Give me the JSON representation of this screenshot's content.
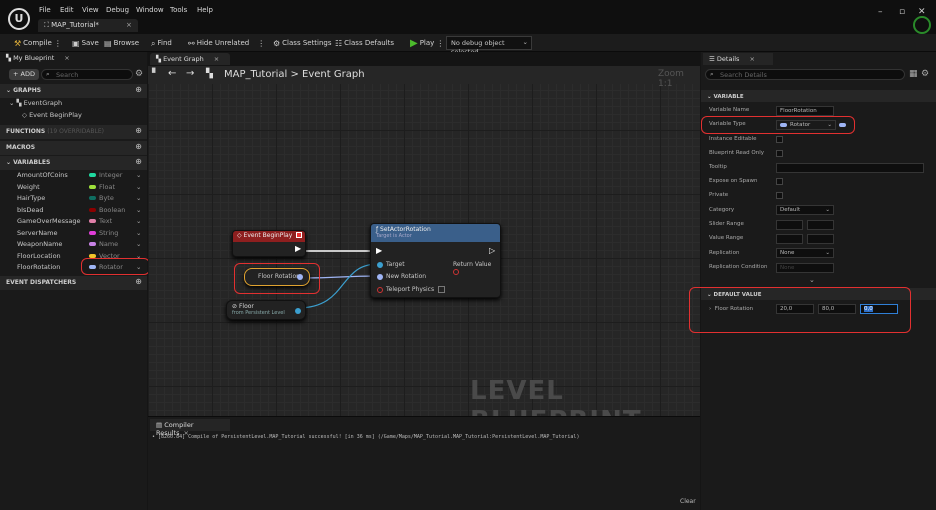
{
  "window": {
    "tab": "MAP_Tutorial*",
    "menus": [
      "File",
      "Edit",
      "View",
      "Debug",
      "Window",
      "Tools",
      "Help"
    ]
  },
  "toolbar": {
    "compile": "Compile",
    "save": "Save",
    "browse": "Browse",
    "find": "Find",
    "hide_unrelated": "Hide Unrelated",
    "class_settings": "Class Settings",
    "class_defaults": "Class Defaults",
    "play": "Play",
    "debug_select": "No debug object selected"
  },
  "myblueprint": {
    "tab": "My Blueprint",
    "add": "ADD",
    "search_ph": "Search",
    "graphs": "GRAPHS",
    "eventgraph": "EventGraph",
    "begin_play": "Event BeginPlay",
    "functions": "FUNCTIONS",
    "functions_note": "(19 OVERRIDABLE)",
    "macros": "MACROS",
    "variables": "VARIABLES",
    "event_dispatchers": "EVENT DISPATCHERS",
    "vars": [
      {
        "name": "AmountOfCoins",
        "type": "Integer",
        "color": "#1fd9a0"
      },
      {
        "name": "Weight",
        "type": "Float",
        "color": "#9ee03b"
      },
      {
        "name": "HairType",
        "type": "Byte",
        "color": "#0f6e61"
      },
      {
        "name": "bIsDead",
        "type": "Boolean",
        "color": "#8b0000"
      },
      {
        "name": "GameOverMessage",
        "type": "Text",
        "color": "#e07fa8"
      },
      {
        "name": "ServerName",
        "type": "String",
        "color": "#e03dd8"
      },
      {
        "name": "WeaponName",
        "type": "Name",
        "color": "#c882e6"
      },
      {
        "name": "FloorLocation",
        "type": "Vector",
        "color": "#f2c42b"
      },
      {
        "name": "FloorRotation",
        "type": "Rotator",
        "color": "#9fb5f5"
      }
    ]
  },
  "graph": {
    "tab": "Event Graph",
    "breadcrumb_map": "MAP_Tutorial",
    "breadcrumb_sep": ">",
    "breadcrumb_graph": "Event Graph",
    "zoom": "Zoom 1:1",
    "watermark": "LEVEL BLUEPRINT",
    "begin_play": "Event BeginPlay",
    "floor_rotation": "Floor Rotation",
    "floor": "Floor",
    "floor_sub": "from Persistent Level",
    "set_actor": {
      "title": "SetActorRotation",
      "subtitle": "Target is Actor",
      "target": "Target",
      "new_rotation": "New Rotation",
      "teleport": "Teleport Physics",
      "return_value": "Return Value"
    }
  },
  "compiler": {
    "tab": "Compiler Results",
    "message": "• [8260.84] Compile of PersistentLevel.MAP_Tutorial successful! [in 36 ms] (/Game/Maps/MAP_Tutorial.MAP_Tutorial:PersistentLevel.MAP_Tutorial)",
    "clear": "Clear"
  },
  "details": {
    "tab": "Details",
    "search_ph": "Search Details",
    "section_variable": "VARIABLE",
    "variable_name_label": "Variable Name",
    "variable_name": "FloorRotation",
    "variable_type_label": "Variable Type",
    "variable_type": "Rotator",
    "instance_editable": "Instance Editable",
    "bp_readonly": "Blueprint Read Only",
    "tooltip": "Tooltip",
    "expose": "Expose on Spawn",
    "private": "Private",
    "category_label": "Category",
    "category": "Default",
    "slider": "Slider Range",
    "value_range": "Value Range",
    "replication_label": "Replication",
    "replication": "None",
    "rep_condition": "Replication Condition",
    "rep_condition_value": "None",
    "section_default": "DEFAULT VALUE",
    "floor_rotation": "Floor Rotation",
    "rot_x": "20,0",
    "rot_y": "80,0",
    "rot_z": "0,0"
  }
}
